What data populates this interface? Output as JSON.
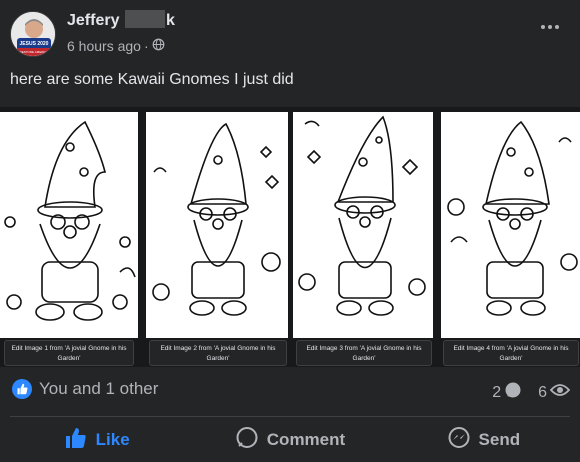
{
  "post": {
    "author_first": "Jeffery",
    "author_last_visible": "k",
    "timestamp": "6 hours ago",
    "privacy_icon": "globe-icon",
    "text": "here are some Kawaii Gnomes I just did",
    "avatar_badge": "JESUS 2020",
    "avatar_sub": "RESTORE AMERICA"
  },
  "images": [
    {
      "caption": "Edit Image 1 from 'A jovial Gnome in his Garden'"
    },
    {
      "caption": "Edit Image 2 from 'A jovial Gnome in his Garden'"
    },
    {
      "caption": "Edit Image 3 from 'A jovial Gnome in his Garden'"
    },
    {
      "caption": "Edit Image 4 from 'A jovial Gnome in his Garden'"
    }
  ],
  "reactions": {
    "icon": "thumbs-up-icon",
    "text": "You and 1 other",
    "comments_count": "2",
    "views_count": "6"
  },
  "actions": {
    "like": "Like",
    "comment": "Comment",
    "send": "Send"
  },
  "colors": {
    "background": "#242526",
    "accent": "#2d88ff",
    "text_primary": "#e4e6eb",
    "text_secondary": "#b0b3b8"
  }
}
